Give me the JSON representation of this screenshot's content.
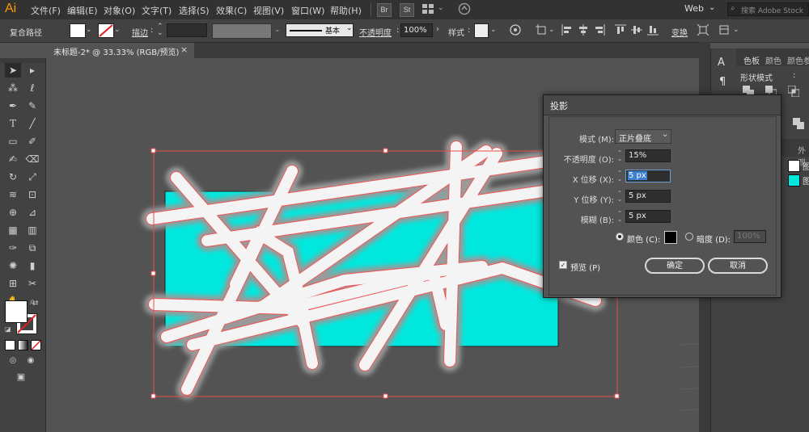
{
  "app": {
    "logo": "Ai"
  },
  "menu": [
    "文件(F)",
    "编辑(E)",
    "对象(O)",
    "文字(T)",
    "选择(S)",
    "效果(C)",
    "视图(V)",
    "窗口(W)",
    "帮助(H)"
  ],
  "menubar_right": {
    "bridge": "Br",
    "stock": "St",
    "workspace": "Web",
    "search_placeholder": "搜索 Adobe Stock"
  },
  "control_bar": {
    "selection_type": "复合路径",
    "stroke_label": "描边",
    "stroke_style": "基本",
    "opacity_label": "不透明度",
    "opacity_value": "100%",
    "style_label": "样式",
    "transform_label": "变换"
  },
  "document_tab": {
    "label": "未标题-2* @ 33.33% (RGB/预览)",
    "close": "×"
  },
  "right_panel": {
    "tabs": [
      "色板",
      "颜色",
      "颜色参"
    ],
    "shape_modes_label": "形状模式",
    "tab2": "外观",
    "layer_items": [
      "图",
      "图"
    ]
  },
  "dialog": {
    "title": "投影",
    "mode_label": "模式 (M):",
    "mode_value": "正片叠底",
    "opacity_label": "不透明度 (O):",
    "opacity_value": "15%",
    "x_label": "X 位移 (X):",
    "x_value": "5 px",
    "y_label": "Y 位移 (Y):",
    "y_value": "5 px",
    "blur_label": "模糊 (B):",
    "blur_value": "5 px",
    "color_label": "颜色 (C):",
    "darkness_label": "暗度 (D):",
    "darkness_value": "100%",
    "preview_label": "预览 (P)",
    "ok_label": "确定",
    "cancel_label": "取消"
  },
  "colors": {
    "fill": "#00e8de",
    "accent": "#ff9a00",
    "selection": "#e05050"
  }
}
